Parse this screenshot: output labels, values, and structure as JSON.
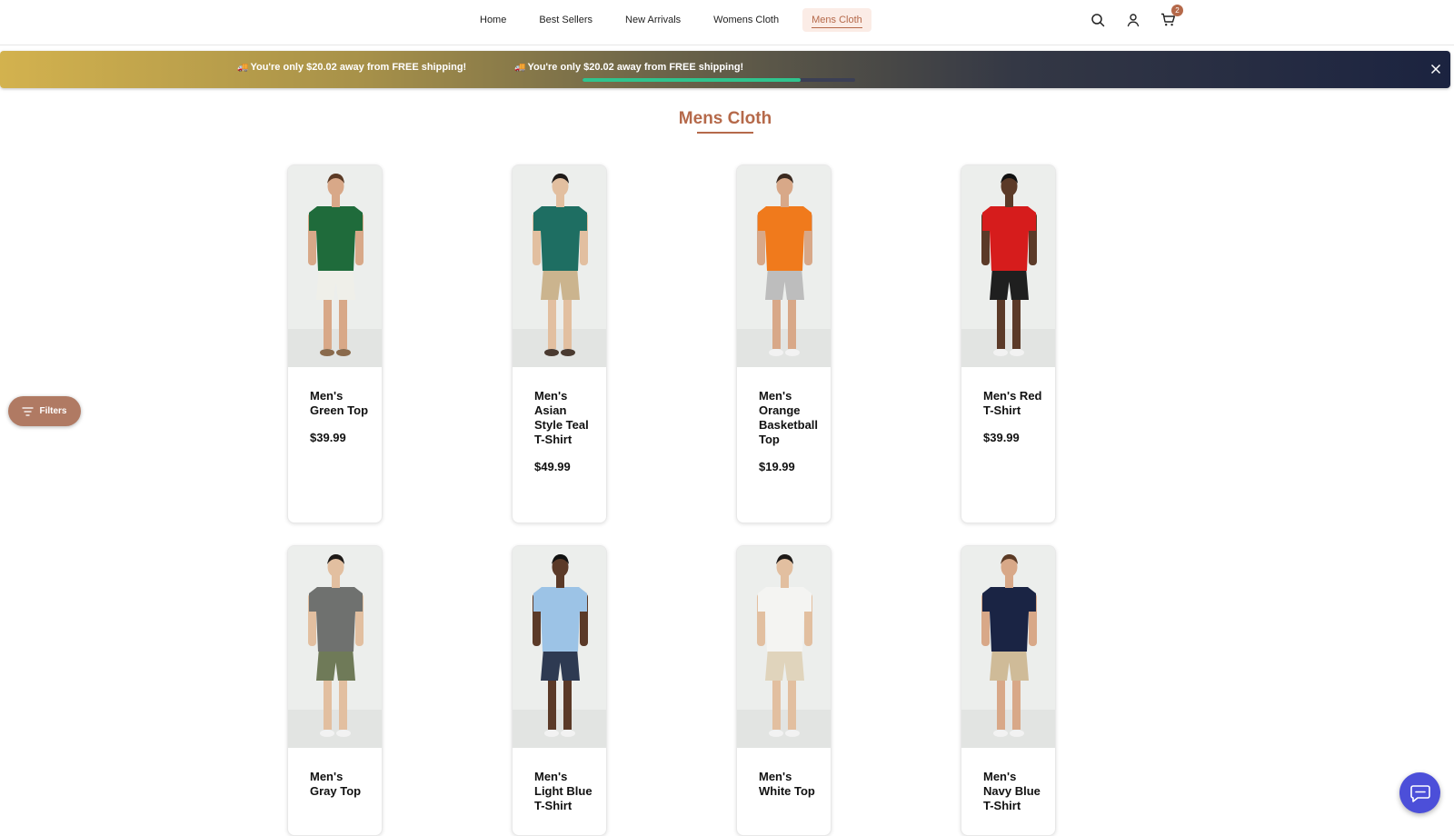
{
  "nav": {
    "links": [
      "Home",
      "Best Sellers",
      "New Arrivals",
      "Womens Cloth",
      "Mens Cloth"
    ],
    "active": "Mens Cloth",
    "cart_count": "2"
  },
  "shipping": {
    "message_left": "You're only $20.02 away from FREE shipping!",
    "message_right": "You're only $20.02 away from FREE shipping!",
    "progress": 0.8
  },
  "page": {
    "title": "Mens Cloth",
    "filters_label": "Filters"
  },
  "products": [
    {
      "name": "Men's Green Top",
      "price": "$39.99",
      "shirt": "#1f6b3b",
      "bottom": "#efefe9",
      "skin": "#d8a888",
      "hair": "#5b3a25",
      "shoes": "#8a6a4c"
    },
    {
      "name": "Men's Asian Style Teal T-Shirt",
      "price": "$49.99",
      "shirt": "#1e6e62",
      "bottom": "#cbb48e",
      "skin": "#e2bfa0",
      "hair": "#1e1a18",
      "shoes": "#4a3a30"
    },
    {
      "name": "Men's Orange Basketball Top",
      "price": "$19.99",
      "shirt": "#f07a1c",
      "bottom": "#bdbdbd",
      "skin": "#d8a888",
      "hair": "#3b2a20",
      "shoes": "#f2f2f2"
    },
    {
      "name": "Men's Red T-Shirt",
      "price": "$39.99",
      "shirt": "#d61c1c",
      "bottom": "#1f1f1f",
      "skin": "#5b3a28",
      "hair": "#111111",
      "shoes": "#f2f2f2"
    },
    {
      "name": "Men's Gray Top",
      "price": "",
      "shirt": "#6f716f",
      "bottom": "#6f7a58",
      "skin": "#e2bfa0",
      "hair": "#1e1a18",
      "shoes": "#f2f2f2"
    },
    {
      "name": "Men's Light Blue T-Shirt",
      "price": "",
      "shirt": "#9cc3e6",
      "bottom": "#2e3a52",
      "skin": "#5b3a28",
      "hair": "#111111",
      "shoes": "#f2f2f2"
    },
    {
      "name": "Men's White Top",
      "price": "",
      "shirt": "#f4f4f2",
      "bottom": "#e0d4bc",
      "skin": "#e2bfa0",
      "hair": "#1e1a18",
      "shoes": "#f2f2f2"
    },
    {
      "name": "Men's Navy Blue T-Shirt",
      "price": "",
      "shirt": "#1a2444",
      "bottom": "#cfbb98",
      "skin": "#d8a888",
      "hair": "#5b3a25",
      "shoes": "#f2f2f2"
    }
  ],
  "colors": {
    "accent": "#b5694a",
    "chat": "#4c4fd9",
    "progress": "#2fc48e"
  }
}
